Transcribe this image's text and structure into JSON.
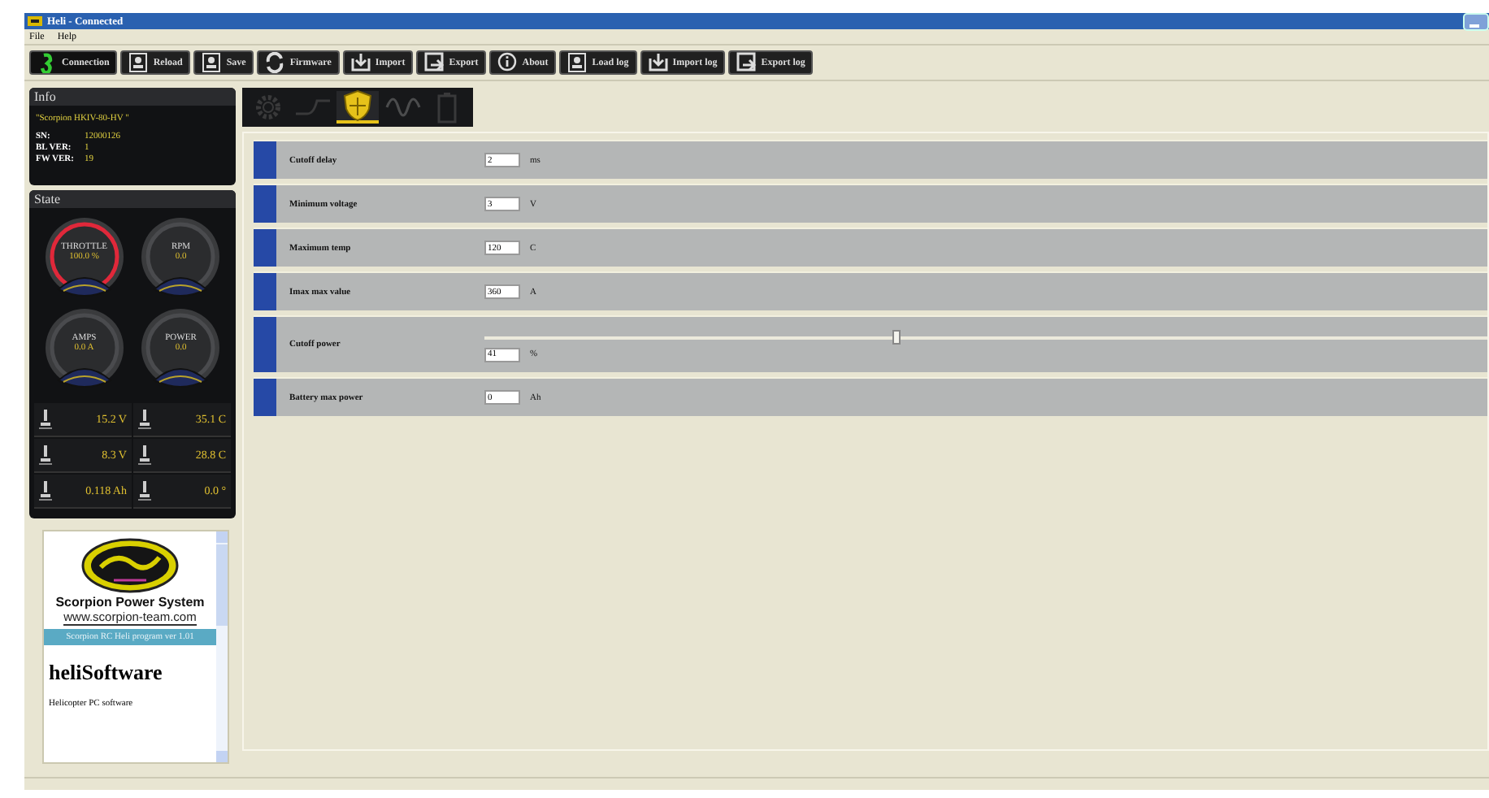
{
  "window": {
    "title": "Heli - Connected"
  },
  "menu": [
    "File",
    "Help"
  ],
  "toolbar": [
    {
      "label": "Connection",
      "kind": "link"
    },
    {
      "label": "Reload",
      "kind": "doc"
    },
    {
      "label": "Save",
      "kind": "doc"
    },
    {
      "label": "Firmware",
      "kind": "refresh"
    },
    {
      "label": "Import",
      "kind": "import"
    },
    {
      "label": "Export",
      "kind": "export"
    },
    {
      "label": "About",
      "kind": "info"
    },
    {
      "label": "Load log",
      "kind": "doc"
    },
    {
      "label": "Import log",
      "kind": "import"
    },
    {
      "label": "Export log",
      "kind": "export"
    }
  ],
  "info": {
    "title": "Info",
    "model": "\"Scorpion HKIV-80-HV \"",
    "fields": [
      {
        "label": "SN:",
        "value": "12000126"
      },
      {
        "label": "BL VER:",
        "value": "1"
      },
      {
        "label": "FW VER:",
        "value": "19"
      }
    ]
  },
  "state": {
    "title": "State",
    "gauges": [
      {
        "label": "THROTTLE",
        "value": "100.0 %",
        "alarm": true
      },
      {
        "label": "RPM",
        "value": "0.0",
        "alarm": false
      },
      {
        "label": "AMPS",
        "value": "0.0 A",
        "alarm": false
      },
      {
        "label": "POWER",
        "value": "0.0",
        "alarm": false
      }
    ],
    "readings": [
      "15.2 V",
      "35.1 C",
      "8.3 V",
      "28.8 C",
      "0.118 Ah",
      "0.0 °"
    ]
  },
  "about": {
    "brand": "Scorpion Power System",
    "url": "www.scorpion-team.com",
    "banner": "Scorpion RC Heli program ver 1.01",
    "title": "heliSoftware",
    "subtitle": "Helicopter PC software"
  },
  "tabs": [
    {
      "kind": "gear",
      "selected": false
    },
    {
      "kind": "curve",
      "selected": false
    },
    {
      "kind": "shield",
      "selected": true
    },
    {
      "kind": "wave",
      "selected": false
    },
    {
      "kind": "battery",
      "selected": false
    }
  ],
  "settings": [
    {
      "label": "Cutoff delay",
      "kind": "field",
      "value": "2",
      "unit": "ms"
    },
    {
      "label": "Minimum voltage",
      "kind": "field",
      "value": "3",
      "unit": "V"
    },
    {
      "label": "Maximum temp",
      "kind": "field",
      "value": "120",
      "unit": "C"
    },
    {
      "label": "Imax max value",
      "kind": "field",
      "value": "360",
      "unit": "A"
    },
    {
      "label": "Cutoff power",
      "kind": "slider",
      "value": "41",
      "unit": "%",
      "level": 0.41
    },
    {
      "label": "Battery max power",
      "kind": "field",
      "value": "0",
      "unit": "Ah"
    }
  ]
}
